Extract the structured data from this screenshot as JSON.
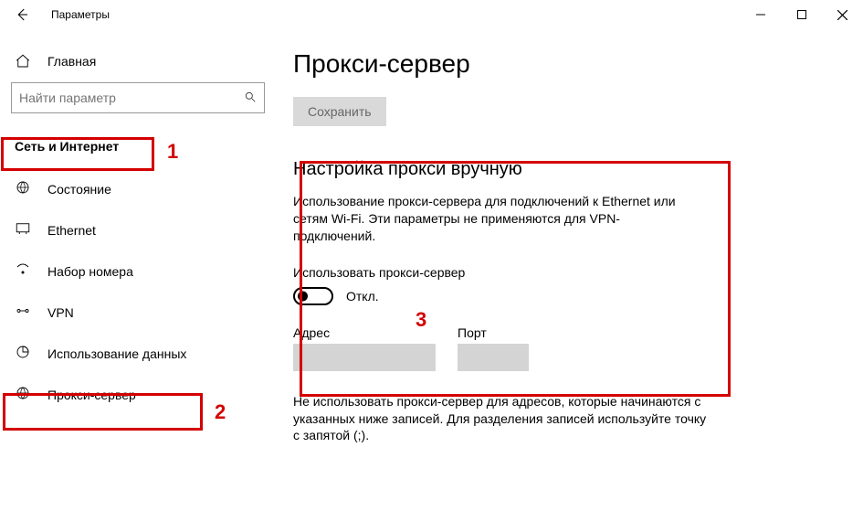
{
  "window": {
    "title": "Параметры"
  },
  "sidebar": {
    "home_label": "Главная",
    "search_placeholder": "Найти параметр",
    "section_label": "Сеть и Интернет",
    "items": [
      {
        "label": "Состояние"
      },
      {
        "label": "Ethernet"
      },
      {
        "label": "Набор номера"
      },
      {
        "label": "VPN"
      },
      {
        "label": "Использование данных"
      },
      {
        "label": "Прокси-сервер"
      }
    ]
  },
  "content": {
    "page_title": "Прокси-сервер",
    "save_label": "Сохранить",
    "manual_heading": "Настройка прокси вручную",
    "manual_desc": "Использование прокси-сервера для подключений к Ethernet или сетям Wi-Fi. Эти параметры не применяются для VPN-подключений.",
    "use_proxy_label": "Использовать прокси-сервер",
    "toggle_state": "Откл.",
    "address_label": "Адрес",
    "port_label": "Порт",
    "exclude_note": "Не использовать прокси-сервер для адресов, которые начинаются с указанных ниже записей. Для разделения записей используйте точку с запятой (;)."
  },
  "annotations": {
    "n1": "1",
    "n2": "2",
    "n3": "3"
  }
}
